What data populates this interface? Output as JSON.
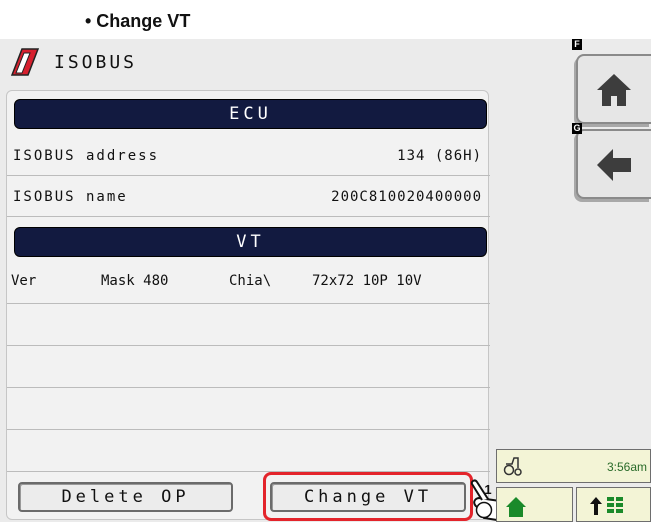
{
  "heading": "• Change VT",
  "header": {
    "title": "ISOBUS"
  },
  "ecu": {
    "header": "ECU",
    "rows": [
      {
        "label": "ISOBUS address",
        "value": "134 (86H)"
      },
      {
        "label": "ISOBUS name",
        "value": "200C810020400000"
      }
    ]
  },
  "vt": {
    "header": "VT",
    "row": {
      "col1": "Ver",
      "col2": "Mask 480",
      "col3": "Chia\\",
      "col4": "72x72 10P 10V"
    }
  },
  "buttons": {
    "delete_op": "Delete OP",
    "change_vt": "Change VT"
  },
  "callout": "1",
  "softkeys": [
    {
      "letter": "F",
      "icon": "home-icon"
    },
    {
      "letter": "G",
      "icon": "back-arrow-icon"
    }
  ],
  "status": {
    "time": "3:56am"
  },
  "colors": {
    "header_bg": "#121a40",
    "highlight": "#e3242b",
    "status_bg": "#f3f4d6"
  }
}
